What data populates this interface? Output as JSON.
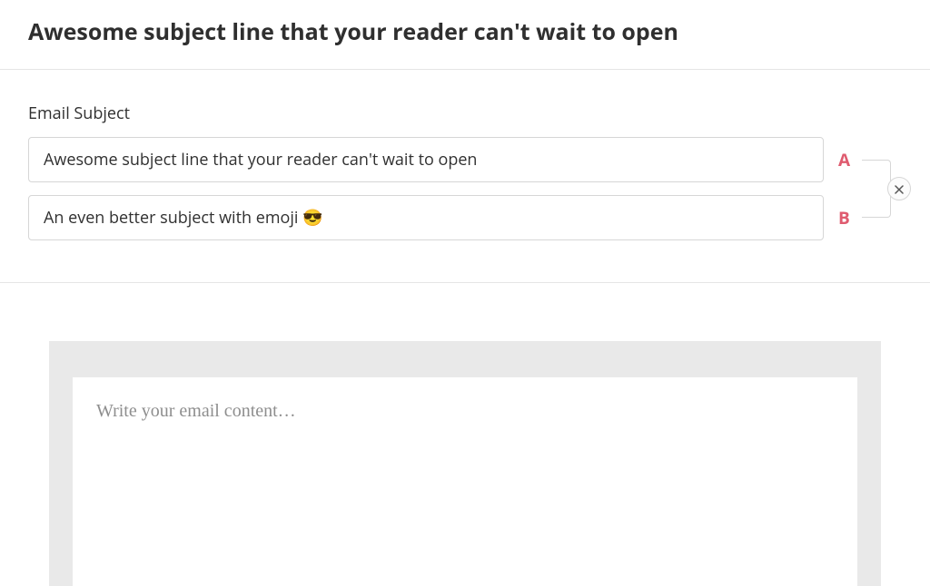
{
  "header": {
    "title": "Awesome subject line that your reader can't wait to open"
  },
  "subject": {
    "label": "Email Subject",
    "variant_a": {
      "badge": "A",
      "value": "Awesome subject line that your reader can't wait to open"
    },
    "variant_b": {
      "badge": "B",
      "value": "An even better subject with emoji 😎"
    },
    "remove_icon": "close-icon"
  },
  "editor": {
    "placeholder": "Write your email content…"
  },
  "colors": {
    "accent": "#df5b6f",
    "border": "#d6d6d6",
    "editor_bg": "#e9e9e9",
    "placeholder": "#8e8e8e"
  }
}
